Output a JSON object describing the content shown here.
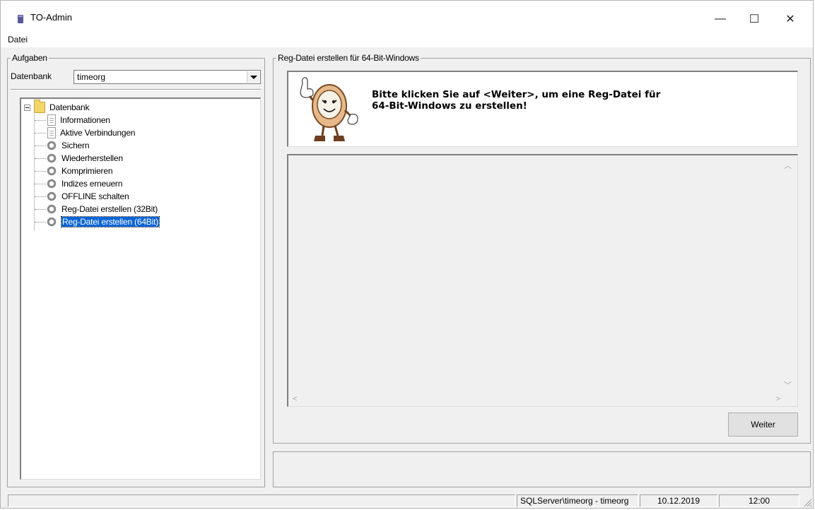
{
  "window": {
    "title": "TO-Admin",
    "minimize_glyph": "—",
    "maximize_glyph": "☐",
    "close_glyph": "✕"
  },
  "menu": {
    "items": [
      "Datei"
    ]
  },
  "tasks": {
    "legend": "Aufgaben",
    "database_label": "Datenbank",
    "database_value": "timeorg",
    "tree": {
      "root": "Datenbank",
      "items": [
        {
          "label": "Informationen",
          "icon": "document-icon"
        },
        {
          "label": "Aktive Verbindungen",
          "icon": "document-icon"
        },
        {
          "label": "Sichern",
          "icon": "gear-icon"
        },
        {
          "label": "Wiederherstellen",
          "icon": "gear-icon"
        },
        {
          "label": "Komprimieren",
          "icon": "gear-icon"
        },
        {
          "label": "Indizes erneuern",
          "icon": "gear-icon"
        },
        {
          "label": "OFFLINE schalten",
          "icon": "gear-icon"
        },
        {
          "label": "Reg-Datei erstellen (32Bit)",
          "icon": "gear-icon"
        },
        {
          "label": "Reg-Datei erstellen (64Bit)",
          "icon": "gear-icon",
          "selected": true
        }
      ]
    }
  },
  "main": {
    "legend": "Reg-Datei erstellen für 64-Bit-Windows",
    "message_line1": "Bitte klicken Sie auf <Weiter>, um eine Reg-Datei für",
    "message_line2": "64-Bit-Windows zu erstellen!",
    "next_button": "Weiter"
  },
  "status": {
    "connection": "SQLServer\\timeorg - timeorg",
    "date": "10.12.2019",
    "time": "12:00"
  },
  "colors": {
    "selection": "#0a64d8",
    "window_bg": "#f0f0f0"
  }
}
